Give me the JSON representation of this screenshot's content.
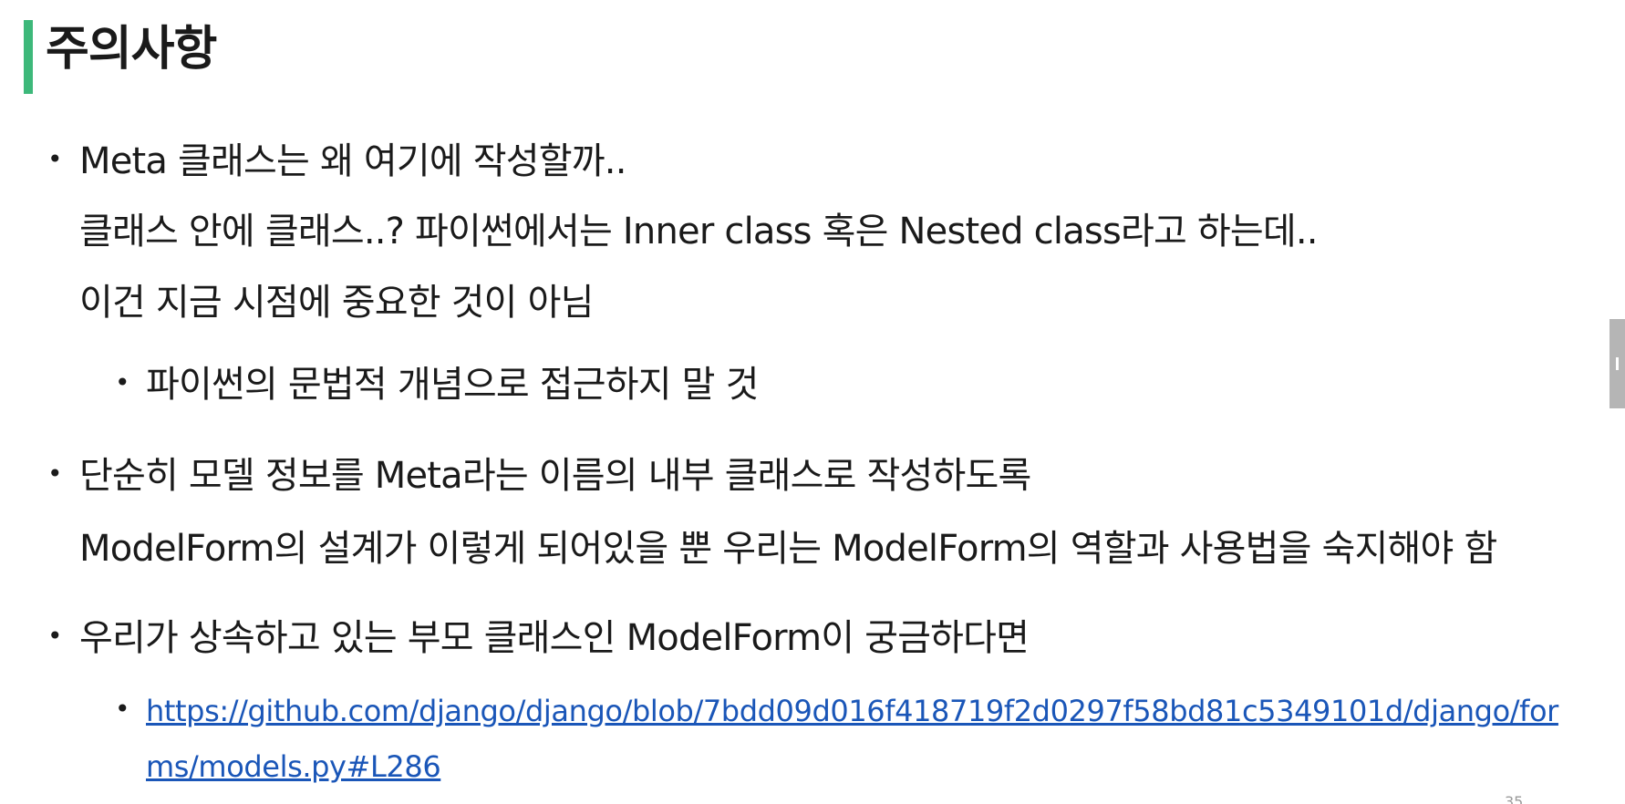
{
  "slide": {
    "title": "주의사항",
    "accent_color": "#3db87a",
    "link_color": "#1a56b8",
    "bullets": [
      {
        "lines": [
          "Meta 클래스는 왜 여기에 작성할까..",
          "클래스 안에 클래스..? 파이썬에서는 Inner class 혹은 Nested class라고 하는데..",
          "이건 지금 시점에 중요한 것이 아님"
        ],
        "sub": [
          "파이썬의 문법적 개념으로 접근하지 말 것"
        ]
      },
      {
        "lines": [
          "단순히 모델 정보를 Meta라는 이름의 내부 클래스로 작성하도록",
          "ModelForm의 설계가 이렇게 되어있을 뿐 우리는 ModelForm의 역할과 사용법을 숙지해야 함"
        ]
      },
      {
        "lines": [
          "우리가 상속하고 있는 부모 클래스인 ModelForm이 궁금하다면"
        ],
        "sub_link": {
          "line1": "https://github.com/django/django/blob/7bdd09d016f418719f2d0297f58bd81c5349101d/django/for",
          "line2": "ms/models.py#L286"
        }
      }
    ],
    "bullet_glyph": "•",
    "page_number": "35"
  }
}
